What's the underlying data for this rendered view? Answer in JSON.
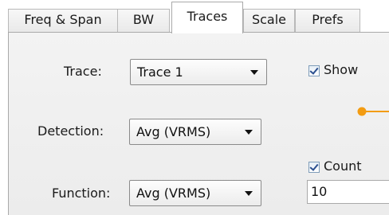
{
  "tabs": [
    {
      "label": "Freq & Span",
      "active": false
    },
    {
      "label": "BW",
      "active": false
    },
    {
      "label": "Traces",
      "active": true
    },
    {
      "label": "Scale",
      "active": false
    },
    {
      "label": "Prefs",
      "active": false
    }
  ],
  "trace": {
    "label": "Trace:",
    "value": "Trace 1"
  },
  "show": {
    "label": "Show",
    "checked": true
  },
  "detection": {
    "label": "Detection:",
    "value": "Avg (VRMS)"
  },
  "count": {
    "label": "Count",
    "checked": true,
    "value": "10"
  },
  "function": {
    "label": "Function:",
    "value": "Avg (VRMS)"
  },
  "colors": {
    "trace_marker": "#f39c12",
    "checkmark": "#2b4f8f"
  }
}
